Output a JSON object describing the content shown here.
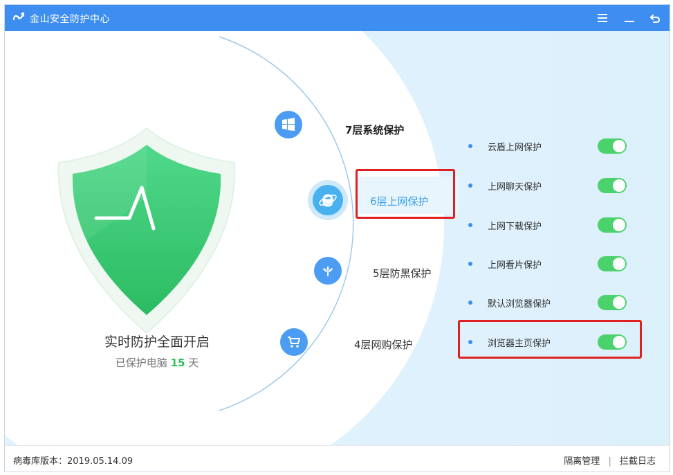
{
  "window": {
    "title": "金山安全防护中心",
    "controls": {
      "menu": "☰",
      "minimize": "—",
      "back": "↶"
    }
  },
  "status": {
    "main_text": "实时防护全面开启",
    "sub_prefix": "已保护电脑",
    "days": "15",
    "sub_suffix": "天"
  },
  "layers": [
    {
      "label": "7层系统保护",
      "icon": "windows-icon"
    },
    {
      "label": "6层上网保护",
      "icon": "ie-browser-icon",
      "active": true
    },
    {
      "label": "5层防黑保护",
      "icon": "sprout-shield-icon"
    },
    {
      "label": "4层网购保护",
      "icon": "shopping-cart-icon"
    }
  ],
  "features": [
    {
      "label": "云盾上网保护",
      "enabled": true
    },
    {
      "label": "上网聊天保护",
      "enabled": true
    },
    {
      "label": "上网下载保护",
      "enabled": true
    },
    {
      "label": "上网看片保护",
      "enabled": true
    },
    {
      "label": "默认浏览器保护",
      "enabled": true
    },
    {
      "label": "浏览器主页保护",
      "enabled": true
    }
  ],
  "footer": {
    "virus_db_version": "病毒库版本：2019.05.14.09",
    "link_1": "隔离管理",
    "separator": "|",
    "link_2": "拦截日志"
  },
  "colors": {
    "titlebar": "#3d8ef0",
    "accent_blue": "#3b8ff0",
    "toggle_on": "#4cd26c",
    "shield_green": "#35c46a",
    "highlight_red": "#e02020"
  }
}
